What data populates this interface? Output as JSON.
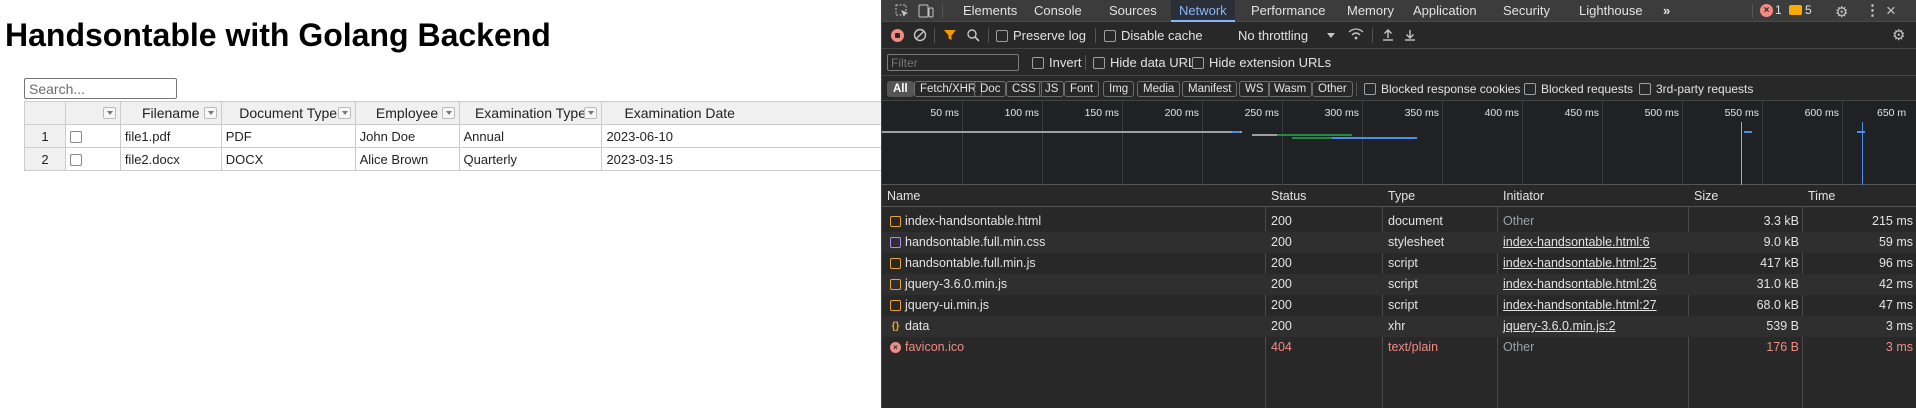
{
  "page": {
    "title": "Handsontable with Golang Backend",
    "search_placeholder": "Search...",
    "columns": [
      "Filename",
      "Document Type",
      "Employee",
      "Examination Type",
      "Examination Date"
    ],
    "rows": [
      {
        "num": "1",
        "filename": "file1.pdf",
        "doc_type": "PDF",
        "employee": "John Doe",
        "exam_type": "Annual",
        "exam_date": "2023-06-10"
      },
      {
        "num": "2",
        "filename": "file2.docx",
        "doc_type": "DOCX",
        "employee": "Alice Brown",
        "exam_type": "Quarterly",
        "exam_date": "2023-03-15"
      }
    ]
  },
  "devtools": {
    "tabs": [
      "Elements",
      "Console",
      "Sources",
      "Network",
      "Performance",
      "Memory",
      "Application",
      "Security",
      "Lighthouse"
    ],
    "active_tab": "Network",
    "more_tabs": "»",
    "error_count": "1",
    "warning_count": "5",
    "toolbar": {
      "preserve_log": "Preserve log",
      "disable_cache": "Disable cache",
      "throttling": "No throttling"
    },
    "filter": {
      "placeholder": "Filter",
      "invert": "Invert",
      "hide_data_urls": "Hide data URLs",
      "hide_extension_urls": "Hide extension URLs"
    },
    "types": [
      "All",
      "Fetch/XHR",
      "Doc",
      "CSS",
      "JS",
      "Font",
      "Img",
      "Media",
      "Manifest",
      "WS",
      "Wasm",
      "Other"
    ],
    "blocked_cookies": "Blocked response cookies",
    "blocked_requests": "Blocked requests",
    "third_party": "3rd-party requests",
    "timeline_ticks": [
      "50 ms",
      "100 ms",
      "150 ms",
      "200 ms",
      "250 ms",
      "300 ms",
      "350 ms",
      "400 ms",
      "450 ms",
      "500 ms",
      "550 ms",
      "600 ms",
      "650 m"
    ],
    "columns": [
      "Name",
      "Status",
      "Type",
      "Initiator",
      "Size",
      "Time"
    ],
    "requests": [
      {
        "name": "index-handsontable.html",
        "status": "200",
        "type": "document",
        "initiator": "Other",
        "size": "3.3 kB",
        "time": "215 ms",
        "icon": "document-icon",
        "color": "#e8a33d"
      },
      {
        "name": "handsontable.full.min.css",
        "status": "200",
        "type": "stylesheet",
        "initiator": "index-handsontable.html:6",
        "size": "9.0 kB",
        "time": "59 ms",
        "icon": "stylesheet-icon",
        "color": "#b388ff"
      },
      {
        "name": "handsontable.full.min.js",
        "status": "200",
        "type": "script",
        "initiator": "index-handsontable.html:25",
        "size": "417 kB",
        "time": "96 ms",
        "icon": "script-icon",
        "color": "#e8a33d"
      },
      {
        "name": "jquery-3.6.0.min.js",
        "status": "200",
        "type": "script",
        "initiator": "index-handsontable.html:26",
        "size": "31.0 kB",
        "time": "42 ms",
        "icon": "script-icon",
        "color": "#e8a33d"
      },
      {
        "name": "jquery-ui.min.js",
        "status": "200",
        "type": "script",
        "initiator": "index-handsontable.html:27",
        "size": "68.0 kB",
        "time": "47 ms",
        "icon": "script-icon",
        "color": "#e8a33d"
      },
      {
        "name": "data",
        "status": "200",
        "type": "xhr",
        "initiator": "jquery-3.6.0.min.js:2",
        "size": "539 B",
        "time": "3 ms",
        "icon": "xhr-icon",
        "color": "#e8a33d"
      },
      {
        "name": "favicon.ico",
        "status": "404",
        "type": "text/plain",
        "initiator": "Other",
        "size": "176 B",
        "time": "3 ms",
        "icon": "error-icon",
        "color": "#f28b82"
      }
    ]
  }
}
